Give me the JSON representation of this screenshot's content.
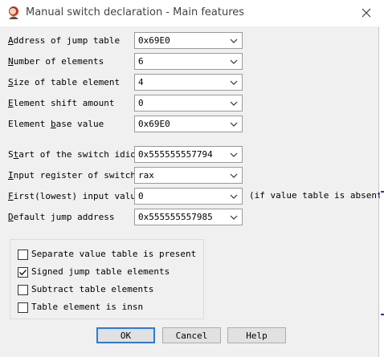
{
  "window": {
    "title": "Manual switch declaration - Main features",
    "app_icon": "ida-app-icon",
    "close_icon": "close-icon"
  },
  "fields": [
    {
      "pre": "",
      "key": "A",
      "post": "ddress of jump table",
      "value": "0x69E0"
    },
    {
      "pre": "",
      "key": "N",
      "post": "umber of elements",
      "value": "6"
    },
    {
      "pre": "",
      "key": "S",
      "post": "ize of table element",
      "value": "4"
    },
    {
      "pre": "",
      "key": "E",
      "post": "lement shift amount",
      "value": "0"
    },
    {
      "pre": "Element ",
      "key": "b",
      "post": "ase value",
      "value": "0x69E0"
    },
    {
      "pre": "S",
      "key": "t",
      "post": "art of the switch idiom",
      "value": "0x555555557794"
    },
    {
      "pre": "",
      "key": "I",
      "post": "nput register of switch",
      "value": "rax"
    },
    {
      "pre": "",
      "key": "F",
      "post": "irst(lowest) input value",
      "value": "0"
    },
    {
      "pre": "",
      "key": "D",
      "post": "efault jump address",
      "value": "0x555555557985"
    }
  ],
  "note": "(if value table is absent)",
  "checkboxes": [
    {
      "label": "Separate value table is present",
      "checked": false
    },
    {
      "label": "Signed jump table elements",
      "checked": true
    },
    {
      "label": "Subtract table elements",
      "checked": false
    },
    {
      "label": "Table element is insn",
      "checked": false
    }
  ],
  "buttons": {
    "ok": "OK",
    "cancel": "Cancel",
    "help": "Help"
  },
  "colors": {
    "default_button_border": "#2b7bd6",
    "background": "#f0f0f0"
  }
}
